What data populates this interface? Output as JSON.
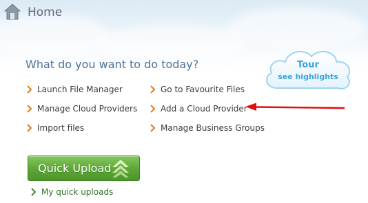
{
  "header": {
    "title": "Home",
    "icon": "home-icon"
  },
  "main": {
    "question": "What do you want to do today?",
    "links": {
      "launch_file_manager": "Launch File Manager",
      "go_to_favourite_files": "Go to Favourite Files",
      "manage_cloud_providers": "Manage Cloud Providers",
      "add_cloud_provider": "Add a Cloud Provider",
      "import_files": "Import files",
      "manage_business_groups": "Manage Business Groups"
    }
  },
  "tour": {
    "title": "Tour",
    "subtitle": "see highlights"
  },
  "quick_upload": {
    "label": "Quick Upload",
    "icon": "double-up-arrow-icon"
  },
  "my_quick_uploads": {
    "label": "My quick uploads"
  },
  "colors": {
    "link_chevron": "#e07b1a",
    "green_chevron": "#3c8a2c",
    "question_text": "#4c7199",
    "tour_text": "#3aa3dd",
    "annotation_arrow": "#e01010",
    "button_green": "#5ea838"
  }
}
